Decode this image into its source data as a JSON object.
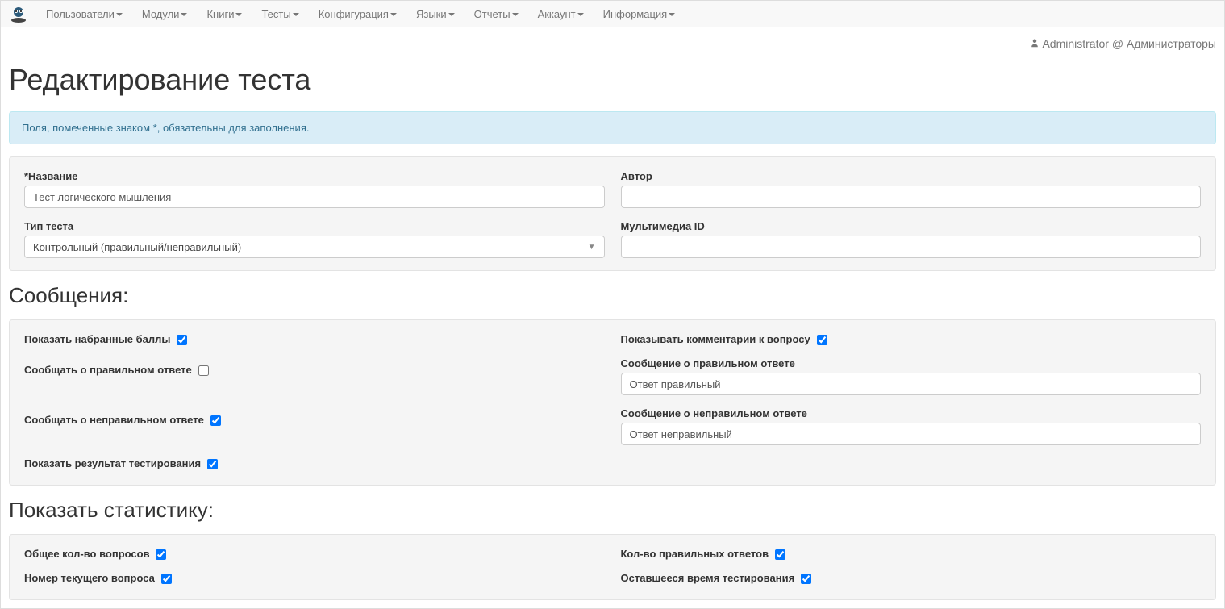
{
  "nav": {
    "items": [
      {
        "label": "Пользователи"
      },
      {
        "label": "Модули"
      },
      {
        "label": "Книги"
      },
      {
        "label": "Тесты"
      },
      {
        "label": "Конфигурация"
      },
      {
        "label": "Языки"
      },
      {
        "label": "Отчеты"
      },
      {
        "label": "Аккаунт"
      },
      {
        "label": "Информация"
      }
    ]
  },
  "user": {
    "name": "Administrator",
    "at": "@",
    "group": "Администраторы"
  },
  "page": {
    "title": "Редактирование теста",
    "info_note": "Поля, помеченные знаком *, обязательны для заполнения."
  },
  "form": {
    "name_label": "*Название",
    "name_value": "Тест логического мышления",
    "author_label": "Автор",
    "author_value": "",
    "type_label": "Тип теста",
    "type_value": "Контрольный (правильный/неправильный)",
    "multimedia_label": "Мультимедиа ID",
    "multimedia_value": ""
  },
  "messages": {
    "header": "Сообщения:",
    "show_scores_label": "Показать набранные баллы",
    "show_comments_label": "Показывать комментарии к вопросу",
    "notify_correct_label": "Сообщать о правильном ответе",
    "msg_correct_label": "Сообщение о правильном ответе",
    "msg_correct_value": "Ответ правильный",
    "notify_incorrect_label": "Сообщать о неправильном ответе",
    "msg_incorrect_label": "Сообщение о неправильном ответе",
    "msg_incorrect_value": "Ответ неправильный",
    "show_result_label": "Показать результат тестирования"
  },
  "stats": {
    "header": "Показать статистику:",
    "total_q_label": "Общее кол-во вопросов",
    "correct_count_label": "Кол-во правильных ответов",
    "current_q_label": "Номер текущего вопроса",
    "time_left_label": "Оставшееся время тестирования"
  }
}
